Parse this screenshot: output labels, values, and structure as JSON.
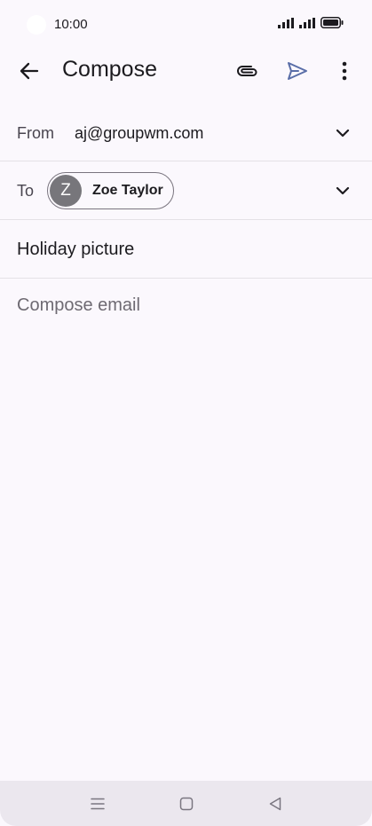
{
  "status_bar": {
    "time": "10:00"
  },
  "app_bar": {
    "title": "Compose"
  },
  "from_row": {
    "label": "From",
    "value": "aj@groupwm.com"
  },
  "to_row": {
    "label": "To",
    "recipient_initial": "Z",
    "recipient_name": "Zoe Taylor"
  },
  "subject": "Holiday picture",
  "body_placeholder": "Compose email",
  "colors": {
    "background": "#fbf8fd",
    "send_accent": "#5a6ea8",
    "avatar": "#77767b",
    "divider": "#e4e1e6",
    "nav_bar": "#ebe7ee"
  },
  "icons": {
    "back": "arrow-left-icon",
    "attach": "paperclip-icon",
    "send": "send-icon",
    "more": "more-vert-icon",
    "expand": "chevron-down-icon",
    "nav_menu": "menu-icon",
    "nav_home": "home-square-icon",
    "nav_back": "back-triangle-icon"
  }
}
